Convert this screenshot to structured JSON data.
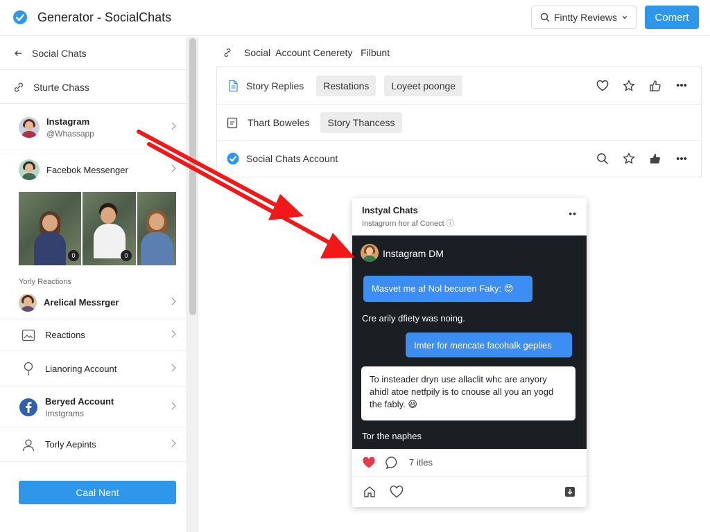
{
  "header": {
    "app_title": "Generator - SocialChats",
    "reviews_label": "Fintty Reviews",
    "primary_label": "Comert"
  },
  "sidebar": {
    "back_label": "Social Chats",
    "link_label": "Sturte Chass",
    "items": [
      {
        "title": "Instagram",
        "subtitle": "@Whassapp"
      },
      {
        "title": "Facebok Messenger"
      }
    ],
    "section_label": "Yorly Reactions",
    "items2": [
      {
        "title": "Arelical Messrger"
      },
      {
        "title": "Reactions"
      },
      {
        "title": "Lianoring Account"
      },
      {
        "title": "Beryed Account",
        "subtitle": "Imstgrams"
      },
      {
        "title": "Torly Aepints"
      }
    ],
    "cta_label": "Caal Nent"
  },
  "main": {
    "breadcrumb": "Social  Account Cenerety   Filbunt",
    "rows": [
      {
        "label": "Story Replies",
        "chips": [
          "Restations",
          "Loyeet poonge"
        ]
      },
      {
        "label": "Thart Boweles",
        "chips": [
          "Story Thancess"
        ]
      },
      {
        "label": "Social Chats Account"
      }
    ]
  },
  "phone": {
    "title": "Instyal Chats",
    "subtitle": "Instagrorn  hor af Conect  ⓘ",
    "more": "••",
    "dm_label": "Instagram DM",
    "msg1": "Masvet me af Nol becuren Faky: 😍",
    "msg2": "Cre arily dfiety was noing.",
    "msg3": "Imter for mencate facohalk geplies",
    "msg4": "To insteader dryn use allaclit whc are anyory ahidl atoe netfpily is to cnouse all you an yogd the fably. 😆",
    "msg5": "Tor the naphes",
    "likes_label": "7 itles"
  },
  "colors": {
    "accent": "#2f97ea",
    "bubble_blue": "#3d8ef2",
    "chat_bg": "#1b1e22",
    "arrow": "#f01818"
  }
}
